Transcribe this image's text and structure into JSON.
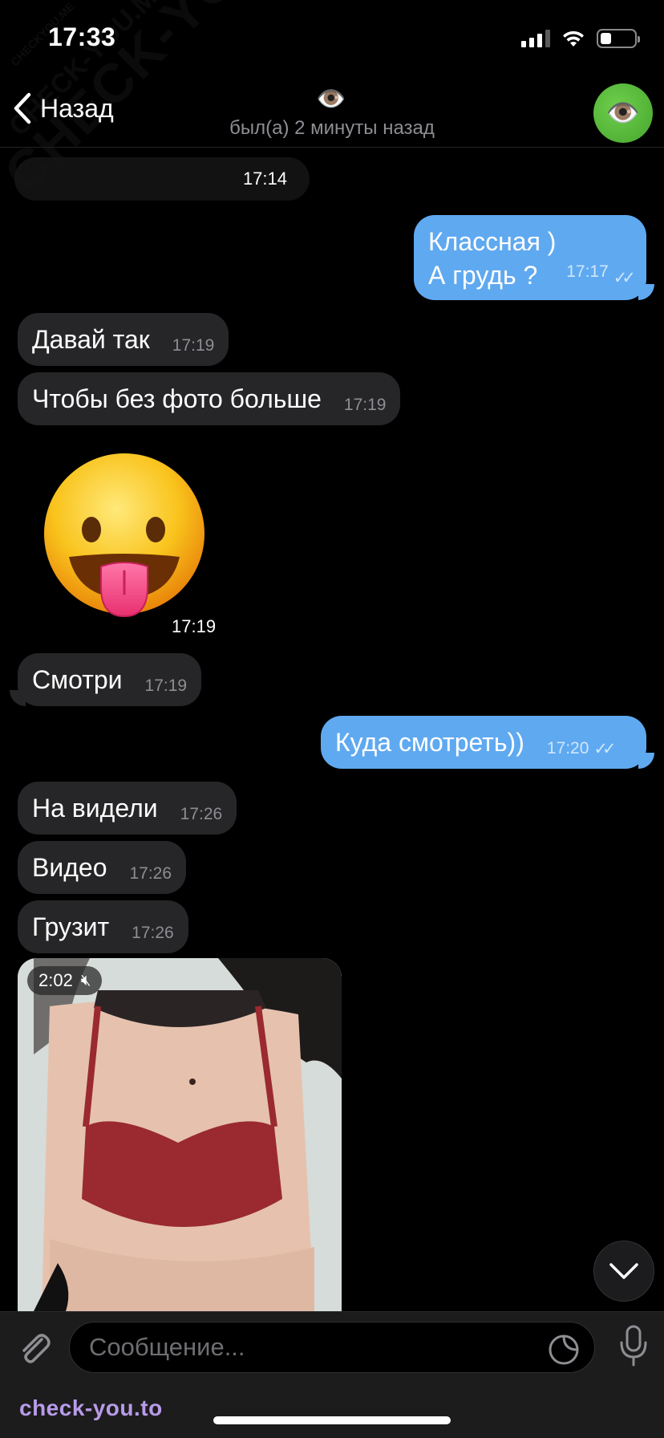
{
  "status_bar": {
    "time": "17:33"
  },
  "header": {
    "back_label": "Назад",
    "chat_emoji": "👁️",
    "status": "был(а) 2 минуты назад",
    "avatar_emoji": "👁️"
  },
  "watermark": {
    "main": "CHECK-YOU.ME",
    "tiny": "CHECKYOU.ME",
    "footer": "check-you.to"
  },
  "date_pill": {
    "time": "17:14"
  },
  "messages": [
    {
      "side": "out",
      "line1": "Классная )",
      "line2": "А грудь ?",
      "time": "17:17"
    },
    {
      "side": "in",
      "text": "Давай так",
      "time": "17:19"
    },
    {
      "side": "in",
      "text": "Чтобы без фото больше",
      "time": "17:19"
    },
    {
      "side": "in",
      "type": "sticker",
      "sticker": "tongue-out-face",
      "time": "17:19"
    },
    {
      "side": "in",
      "text": "Смотри",
      "time": "17:19"
    },
    {
      "side": "out",
      "text": "Куда смотреть))",
      "time": "17:20"
    },
    {
      "side": "in",
      "text": "На видели",
      "time": "17:26"
    },
    {
      "side": "in",
      "text": "Видео",
      "time": "17:26"
    },
    {
      "side": "in",
      "text": "Грузит",
      "time": "17:26"
    },
    {
      "side": "in",
      "type": "video",
      "duration": "2:02",
      "muted": true
    }
  ],
  "input": {
    "placeholder": "Сообщение..."
  },
  "colors": {
    "bg": "#000000",
    "incoming": "#262628",
    "outgoing": "#5fa9f0",
    "input_bar": "#1c1c1d"
  }
}
